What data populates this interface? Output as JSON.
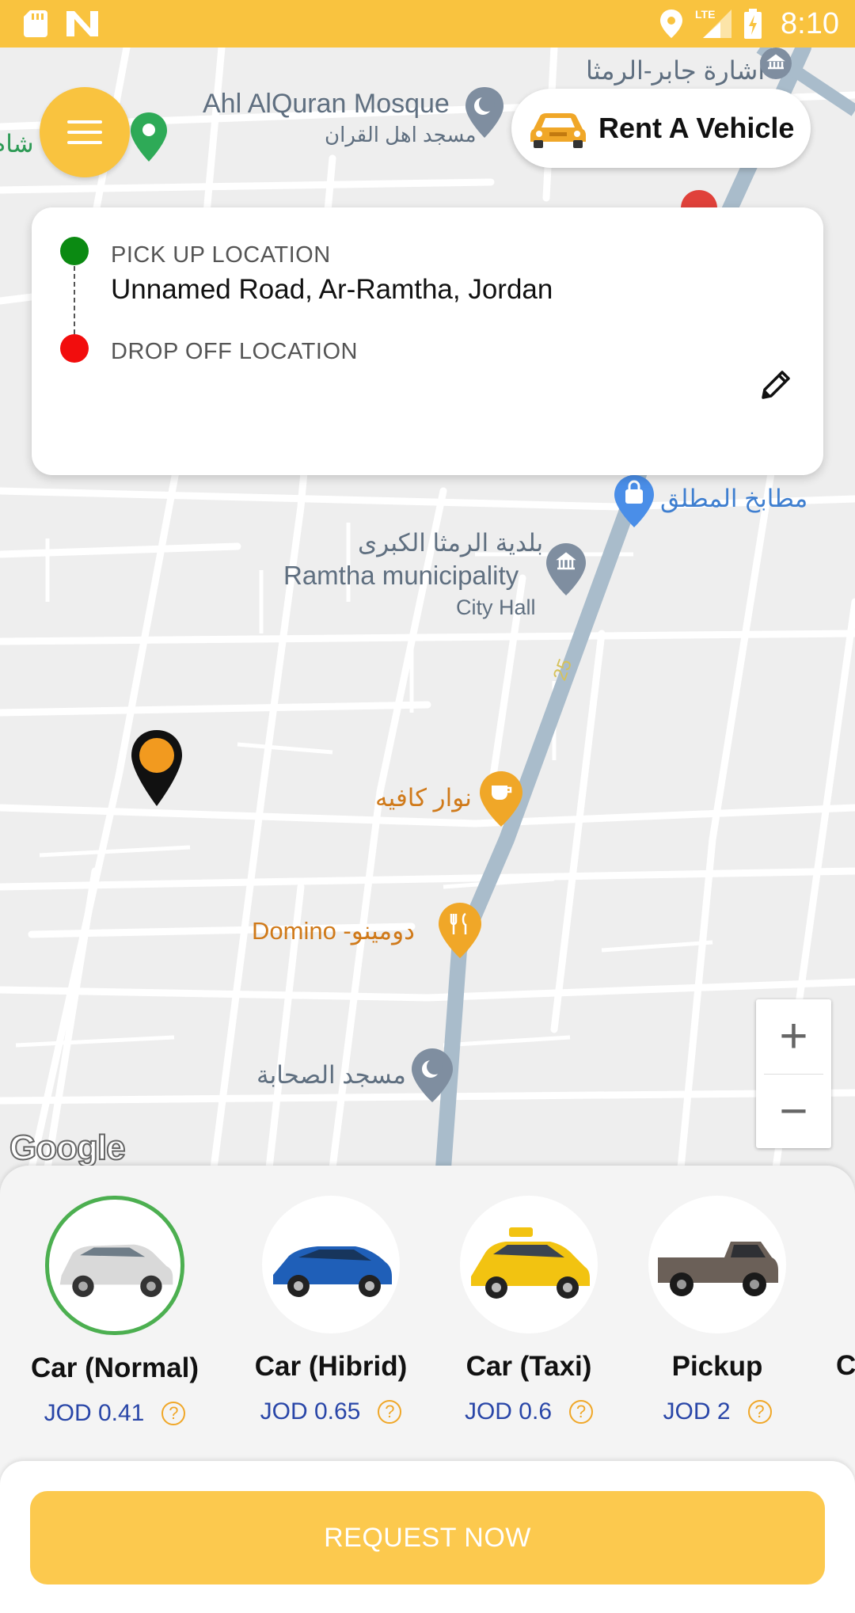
{
  "status_bar": {
    "time": "8:10",
    "network": "LTE",
    "icons": [
      "sd-card-icon",
      "n-app-icon",
      "location-icon",
      "signal-icon",
      "battery-icon"
    ]
  },
  "header": {
    "menu_icon": "hamburger-menu-icon",
    "rent_button_label": "Rent A Vehicle"
  },
  "map": {
    "pois": {
      "jaber_signal": "اشارة جابر-الرمثا",
      "ahl_alquran_en": "Ahl AlQuran Mosque",
      "ahl_alquran_ar": "مسجد اهل القران",
      "left_edge_text": "شام",
      "matabikh": "مطابخ المطلق",
      "ramtha_ar": "بلدية الرمثا الكبرى",
      "ramtha_en": "Ramtha municipality",
      "city_hall": "City Hall",
      "road_number": "25",
      "nawar_cafe": "نوار كافيه",
      "domino": "Domino -دومينو",
      "sahaba_mosque": "مسجد الصحابة"
    },
    "zoom_in": "+",
    "zoom_out": "−",
    "attribution": "Google"
  },
  "location_card": {
    "pickup_label": "PICK UP LOCATION",
    "pickup_value": "Unnamed Road, Ar-Ramtha, Jordan",
    "dropoff_label": "DROP OFF LOCATION",
    "dropoff_value": "",
    "edit_icon": "pencil-edit-icon"
  },
  "vehicles": [
    {
      "name": "Car (Normal)",
      "price": "JOD 0.41",
      "selected": true,
      "color": "#d9d9d9"
    },
    {
      "name": "Car (Hibrid)",
      "price": "JOD 0.65",
      "selected": false,
      "color": "#1f5fb8"
    },
    {
      "name": "Car (Taxi)",
      "price": "JOD 0.6",
      "selected": false,
      "color": "#f2c311"
    },
    {
      "name": "Pickup",
      "price": "JOD 2",
      "selected": false,
      "color": "#6b6058"
    }
  ],
  "partial_vehicle_initial": "C",
  "help_glyph": "?",
  "request_button_label": "REQUEST NOW",
  "colors": {
    "accent": "#f9c33f",
    "pickup_dot": "#0b8a12",
    "dropoff_dot": "#f20d0d",
    "price_text": "#2946a8",
    "selected_ring": "#4caf50"
  }
}
